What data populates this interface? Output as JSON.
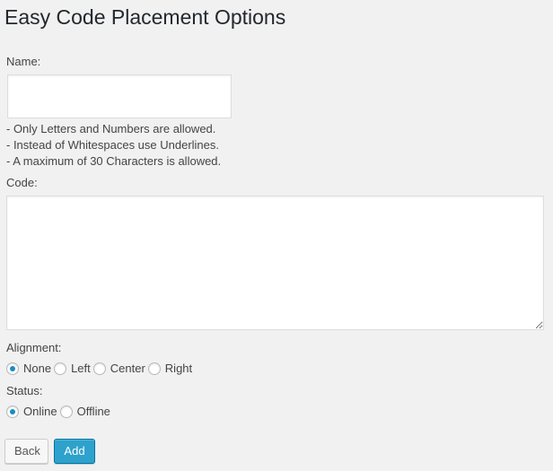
{
  "page": {
    "title": "Easy Code Placement Options"
  },
  "form": {
    "name_label": "Name:",
    "name_value": "",
    "hints": [
      "- Only Letters and Numbers are allowed.",
      "- Instead of Whitespaces use Underlines.",
      "- A maximum of 30 Characters is allowed."
    ],
    "code_label": "Code:",
    "code_value": "",
    "alignment_label": "Alignment:",
    "alignment_options": [
      {
        "label": "None",
        "checked": true
      },
      {
        "label": "Left",
        "checked": false
      },
      {
        "label": "Center",
        "checked": false
      },
      {
        "label": "Right",
        "checked": false
      }
    ],
    "status_label": "Status:",
    "status_options": [
      {
        "label": "Online",
        "checked": true
      },
      {
        "label": "Offline",
        "checked": false
      }
    ]
  },
  "buttons": {
    "back_label": "Back",
    "add_label": "Add"
  },
  "colors": {
    "background": "#f1f1f1",
    "primary_button": "#2ea2cc",
    "radio_checked": "#1e8cbe"
  }
}
